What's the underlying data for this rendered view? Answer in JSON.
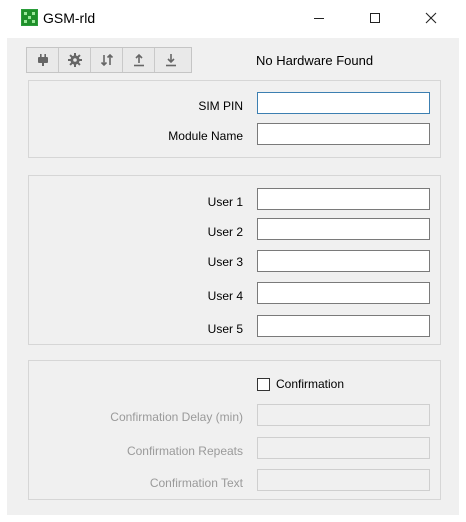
{
  "window": {
    "title": "GSM-rld"
  },
  "toolbar": {
    "buttons": [
      {
        "icon": "plug-icon"
      },
      {
        "icon": "gear-icon"
      },
      {
        "icon": "transfer-icon"
      },
      {
        "icon": "upload-icon"
      },
      {
        "icon": "download-icon"
      }
    ],
    "status": "No Hardware Found"
  },
  "module": {
    "sim_pin_label": "SIM PIN",
    "sim_pin_value": "",
    "module_name_label": "Module Name",
    "module_name_value": ""
  },
  "users": [
    {
      "label": "User 1",
      "value": ""
    },
    {
      "label": "User 2",
      "value": ""
    },
    {
      "label": "User 3",
      "value": ""
    },
    {
      "label": "User 4",
      "value": ""
    },
    {
      "label": "User 5",
      "value": ""
    }
  ],
  "confirmation": {
    "checkbox_label": "Confirmation",
    "checked": false,
    "delay_label": "Confirmation Delay (min)",
    "delay_value": "",
    "repeats_label": "Confirmation Repeats",
    "repeats_value": "",
    "text_label": "Confirmation Text",
    "text_value": ""
  },
  "colors": {
    "background": "#f0f0f0",
    "disabled_text": "#9a9a9a",
    "focus_border": "#3c7fb1",
    "app_icon": "#1f8f2a"
  }
}
